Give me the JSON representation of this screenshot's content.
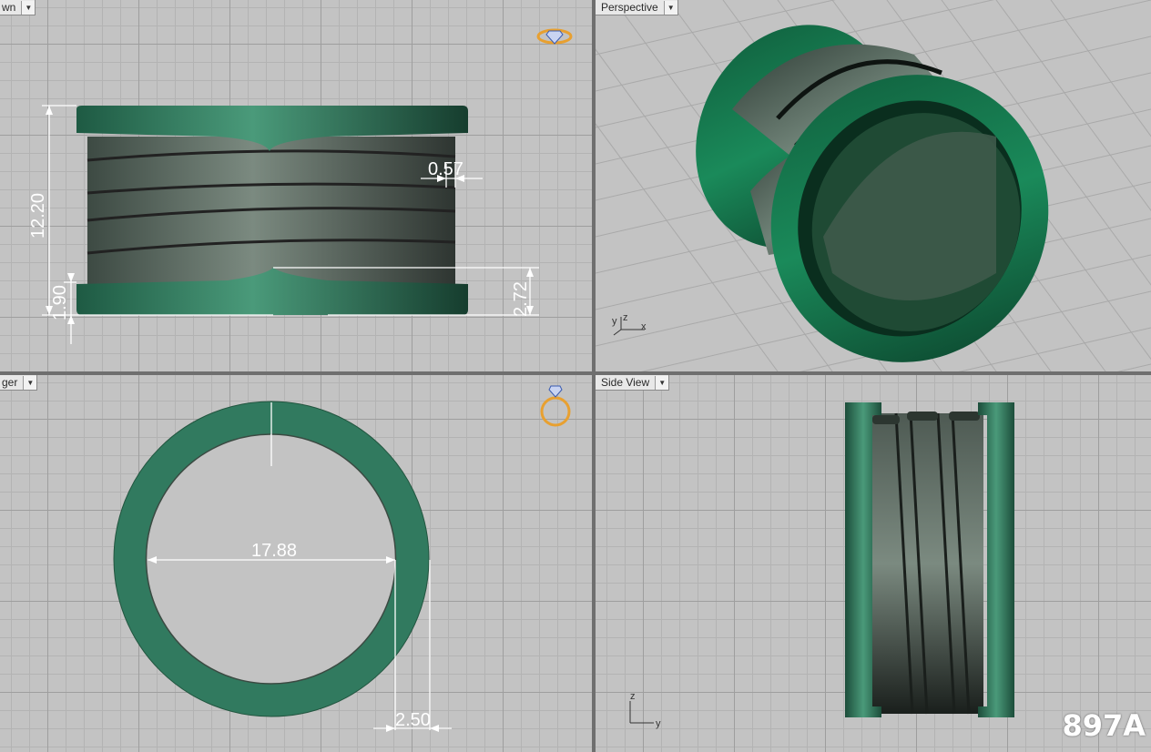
{
  "viewports": {
    "front": {
      "label": "wn"
    },
    "perspective": {
      "label": "Perspective"
    },
    "top": {
      "label": "ger"
    },
    "side": {
      "label": "Side View"
    }
  },
  "dimensions": {
    "height": "12.20",
    "gap": "0.57",
    "band_lower": "1.90",
    "band_right": "2.72",
    "inner_diameter": "17.88",
    "wall": "2.50"
  },
  "axes": {
    "perspective": {
      "x": "x",
      "y": "y",
      "z": "z"
    },
    "side": {
      "z": "z",
      "y": "y"
    }
  },
  "watermark": "897A",
  "colors": {
    "ring_green": "#2f7a5c",
    "ring_gray": "#5e6b62",
    "viewport_bg": "#c3c3c3"
  }
}
